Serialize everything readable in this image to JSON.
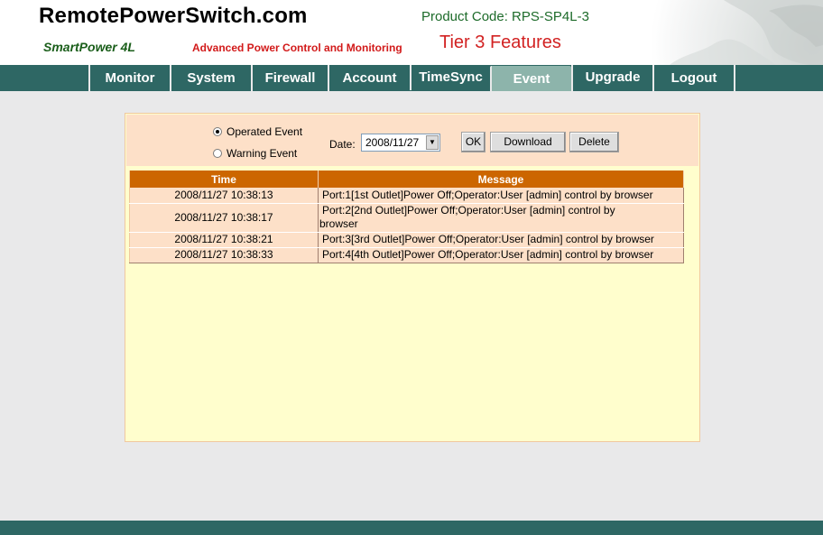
{
  "header": {
    "site_title": "RemotePowerSwitch.com",
    "product_name": "SmartPower 4L",
    "tagline": "Advanced Power Control and Monitoring",
    "product_code": "Product Code: RPS-SP4L-3",
    "tier": "Tier 3 Features"
  },
  "nav": {
    "items": [
      {
        "label": "Monitor"
      },
      {
        "label": "System"
      },
      {
        "label": "Firewall"
      },
      {
        "label": "Account"
      },
      {
        "label": "TimeSync"
      },
      {
        "label": "Event"
      },
      {
        "label": "Upgrade"
      },
      {
        "label": "Logout"
      }
    ],
    "active": "Event"
  },
  "filter": {
    "operated_label": "Operated Event",
    "warning_label": "Warning Event",
    "selected": "Operated Event",
    "date_label": "Date:",
    "date_value": "2008/11/27",
    "ok_label": "OK",
    "download_label": "Download",
    "delete_label": "Delete"
  },
  "table": {
    "headers": [
      "Time",
      "Message"
    ],
    "rows": [
      {
        "time": "2008/11/27 10:38:13",
        "message": "Port:1[1st Outlet]Power Off;Operator:User [admin] control by browser"
      },
      {
        "time": "2008/11/27 10:38:17",
        "message": "Port:2[2nd Outlet]Power Off;Operator:User [admin] control by browser"
      },
      {
        "time": "2008/11/27 10:38:21",
        "message": "Port:3[3rd Outlet]Power Off;Operator:User [admin] control by browser"
      },
      {
        "time": "2008/11/27 10:38:33",
        "message": "Port:4[4th Outlet]Power Off;Operator:User [admin] control by browser"
      }
    ]
  },
  "colors": {
    "nav_bar": "#2e6764",
    "nav_active": "#8db4ab",
    "table_header": "#cc6600",
    "row_bg": "#fde0c8",
    "panel_bg": "#fffecd",
    "title_green": "#1d6b2a",
    "tier_red": "#d22222"
  },
  "icons": {
    "radio_checked": "radio-checked-icon",
    "radio_unchecked": "radio-unchecked-icon",
    "dropdown": "chevron-down-icon",
    "globe": "globe-map-icon"
  }
}
